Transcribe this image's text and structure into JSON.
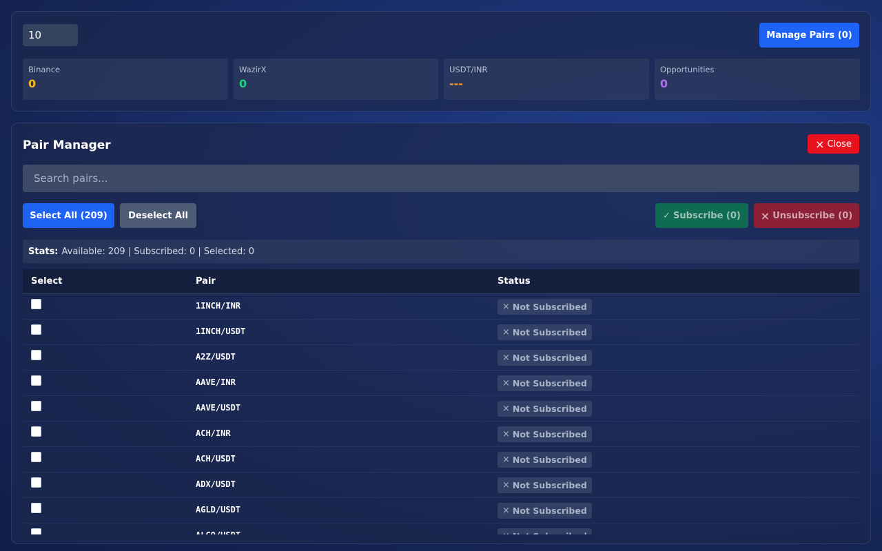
{
  "header": {
    "count_value": "10",
    "manage_pairs_label": "Manage Pairs (0)",
    "stats": [
      {
        "label": "Binance",
        "value": "0",
        "color": "#f5b81c"
      },
      {
        "label": "WazirX",
        "value": "0",
        "color": "#1fd181"
      },
      {
        "label": "USDT/INR",
        "value": "---",
        "color": "#f29a28"
      },
      {
        "label": "Opportunities",
        "value": "0",
        "color": "#b46cf7"
      }
    ]
  },
  "pair_manager": {
    "title": "Pair Manager",
    "close_icon": "×",
    "close_label": "Close",
    "search_placeholder": "Search pairs...",
    "select_all_label": "Select All (209)",
    "deselect_all_label": "Deselect All",
    "subscribe_icon": "✓",
    "subscribe_label": "Subscribe (0)",
    "unsubscribe_icon": "×",
    "unsubscribe_label": "Unsubscribe (0)",
    "stats_label": "Stats:",
    "stats_text": "Available: 209 | Subscribed: 0 | Selected: 0",
    "columns": [
      "Select",
      "Pair",
      "Status"
    ],
    "status_icon": "×",
    "rows": [
      {
        "pair": "1INCH/INR",
        "status": "Not Subscribed"
      },
      {
        "pair": "1INCH/USDT",
        "status": "Not Subscribed"
      },
      {
        "pair": "A2Z/USDT",
        "status": "Not Subscribed"
      },
      {
        "pair": "AAVE/INR",
        "status": "Not Subscribed"
      },
      {
        "pair": "AAVE/USDT",
        "status": "Not Subscribed"
      },
      {
        "pair": "ACH/INR",
        "status": "Not Subscribed"
      },
      {
        "pair": "ACH/USDT",
        "status": "Not Subscribed"
      },
      {
        "pair": "ADX/USDT",
        "status": "Not Subscribed"
      },
      {
        "pair": "AGLD/USDT",
        "status": "Not Subscribed"
      },
      {
        "pair": "ALGO/USDT",
        "status": "Not Subscribed"
      }
    ]
  }
}
